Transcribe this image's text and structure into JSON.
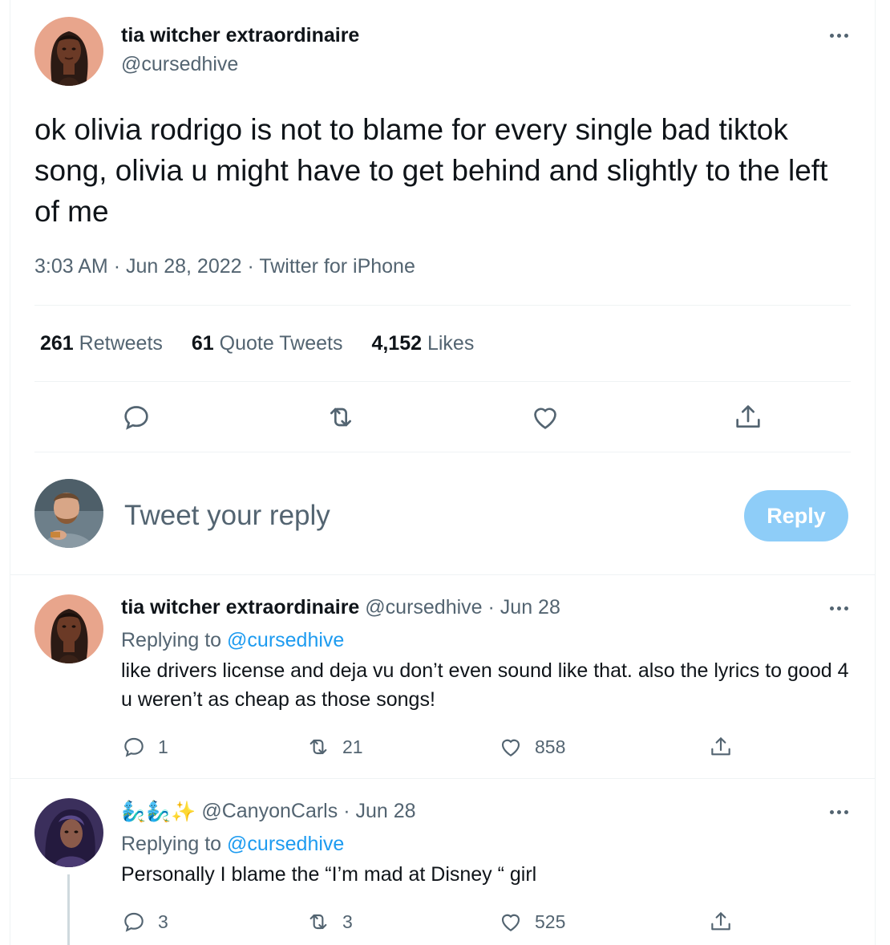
{
  "tweet": {
    "author_name": "tia witcher extraordinaire",
    "author_handle": "@cursedhive",
    "text": "ok olivia rodrigo is not to blame for every single bad tiktok song, olivia u might have to get behind and slightly to the left of me",
    "time": "3:03 AM",
    "date": "Jun 28, 2022",
    "source": "Twitter for iPhone",
    "separator": "·",
    "stats": {
      "retweets_count": "261",
      "retweets_label": "Retweets",
      "quotes_count": "61",
      "quotes_label": "Quote Tweets",
      "likes_count": "4,152",
      "likes_label": "Likes"
    },
    "icons": [
      "reply-icon",
      "retweet-icon",
      "like-icon",
      "share-icon"
    ]
  },
  "composer": {
    "placeholder": "Tweet your reply",
    "button_label": "Reply",
    "button_color": "#8ecdf8"
  },
  "replies": [
    {
      "author_name": "tia witcher extraordinaire",
      "author_handle": "@cursedhive",
      "date": "Jun 28",
      "replying_prefix": "Replying to",
      "replying_to": "@cursedhive",
      "text": "like drivers license and deja vu don’t even sound like that. also the lyrics to good 4 u weren’t as cheap as those songs!",
      "reply_count": "1",
      "retweet_count": "21",
      "like_count": "858"
    },
    {
      "author_name_emoji": "🧞‍♂️🧞‍♂️✨",
      "author_handle": "@CanyonCarls",
      "date": "Jun 28",
      "replying_prefix": "Replying to",
      "replying_to": "@cursedhive",
      "text": "Personally I blame the “I’m mad at Disney “ girl",
      "reply_count": "3",
      "retweet_count": "3",
      "like_count": "525"
    }
  ],
  "colors": {
    "text": "#0f1419",
    "secondary": "#536471",
    "link": "#1d9bf0",
    "border": "#eff3f4"
  }
}
